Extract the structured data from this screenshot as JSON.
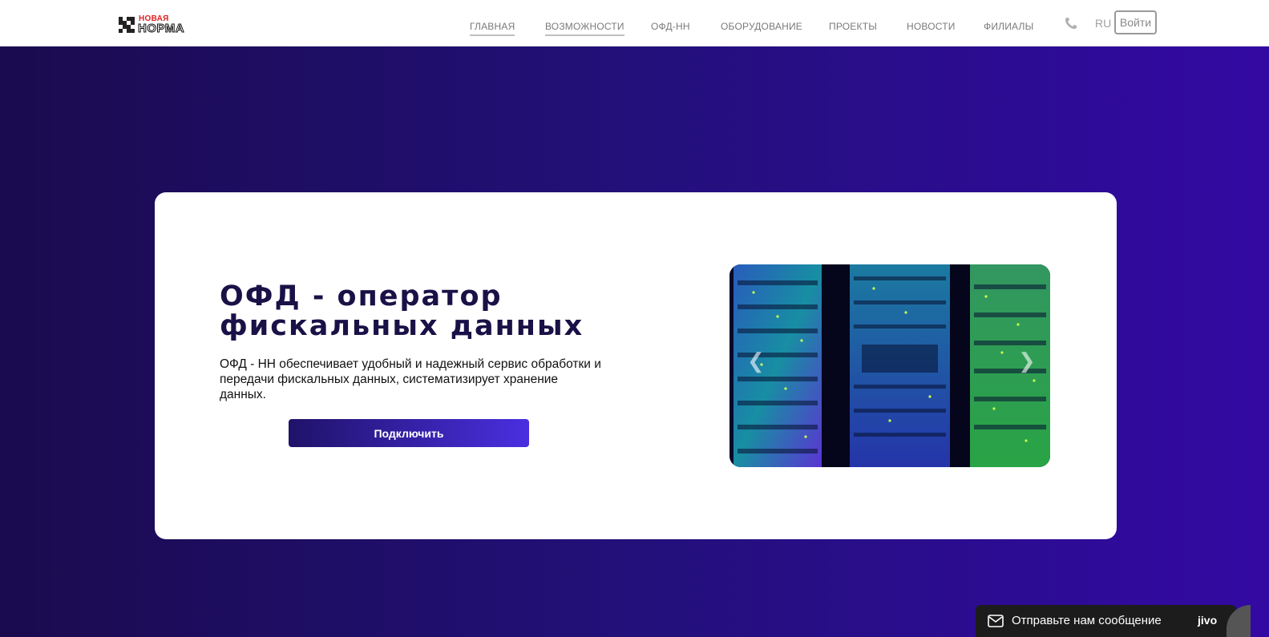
{
  "header": {
    "logo": {
      "top": "НОВАЯ",
      "bottom": "НОРМА"
    },
    "nav": [
      {
        "label": "ГЛАВНАЯ",
        "active": true
      },
      {
        "label": "ВОЗМОЖНОСТИ",
        "active": true
      },
      {
        "label": "ОФД-НН",
        "active": false
      },
      {
        "label": "ОБОРУДОВАНИЕ",
        "active": false
      },
      {
        "label": "ПРОЕКТЫ",
        "active": false
      },
      {
        "label": "НОВОСТИ",
        "active": false
      },
      {
        "label": "ФИЛИАЛЫ",
        "active": false
      }
    ],
    "phone_icon": "phone-icon",
    "lang": "RU",
    "login_label": "Войти"
  },
  "hero": {
    "title": "ОФД - оператор фискальных данных",
    "description": "ОФД - НН обеспечивает удобный и надежный сервис обработки и передачи фискальных данных, систематизирует хранение данных.",
    "button_label": "Подключить",
    "carousel": {
      "image": "server-racks",
      "prev_icon": "chevron-left-icon",
      "next_icon": "chevron-right-icon"
    }
  },
  "chat_widget": {
    "label": "Отправьте нам сообщение",
    "brand": "jivo",
    "icon": "mail-icon"
  },
  "colors": {
    "bg_dark": "#1a0b4f",
    "bg_light": "#3309a3",
    "title": "#1a1147",
    "button_start": "#1f1269",
    "button_end": "#4a2fe0"
  }
}
